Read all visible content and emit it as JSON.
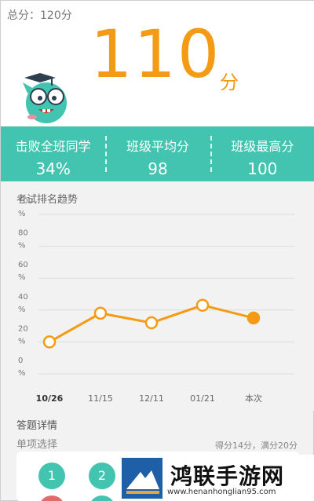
{
  "header": {
    "total_label": "总分：120分",
    "score": "110",
    "score_unit": "分"
  },
  "stats": [
    {
      "label": "击败全班同学",
      "value": "34%"
    },
    {
      "label": "班级平均分",
      "value": "98"
    },
    {
      "label": "班级最高分",
      "value": "100"
    }
  ],
  "chart_title": "考试排名趋势",
  "chart_data": {
    "type": "line",
    "categories": [
      "10/26",
      "11/15",
      "12/11",
      "01/21",
      "本次"
    ],
    "values": [
      20,
      38,
      32,
      43,
      35
    ],
    "highlight_last": true,
    "ylim": [
      0,
      100
    ],
    "y_ticks": [
      "100\n%",
      "80\n%",
      "60\n%",
      "40\n%",
      "20\n%",
      "0\n%"
    ],
    "grid": true,
    "line_color": "#f39b14"
  },
  "details": {
    "title": "答题详情",
    "section_name": "单项选择",
    "section_score": "得分14分，满分20分",
    "questions": [
      {
        "num": "1",
        "color": "#43c4b0"
      },
      {
        "num": "2",
        "color": "#43c4b0"
      }
    ],
    "second_row_colors": [
      "#e26a6a",
      "#43c4b0"
    ]
  },
  "watermark": {
    "name": "鸿联手游网",
    "url": "www.henanhonglian95.com"
  },
  "colors": {
    "accent_orange": "#f39b14",
    "teal": "#43c4b0"
  }
}
